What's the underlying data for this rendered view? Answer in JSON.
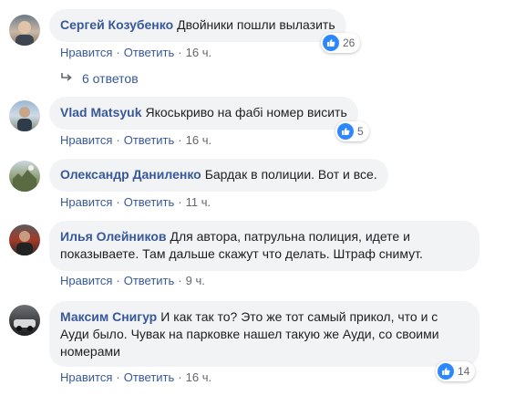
{
  "actions": {
    "like": "Нравится",
    "reply": "Ответить",
    "sep": "·"
  },
  "comments": [
    {
      "author": "Сергей Козубенко",
      "text": "Двойники пошли вылазить",
      "time": "16 ч.",
      "likes": "26"
    },
    {
      "author": "Vlad Matsyuk",
      "text": "Якоськриво на фабі номер висить",
      "time": "16 ч.",
      "likes": "5"
    },
    {
      "author": "Олександр Даниленко",
      "text": "Бардак в полиции. Вот и все.",
      "time": "11 ч."
    },
    {
      "author": "Илья Олейников",
      "text": "Для автора, патрульна полиция, идете и показываете. Там дальше скажут что делать. Штраф снимут.",
      "time": "9 ч."
    },
    {
      "author": "Максим Снигур",
      "text": "И как так то? Это же тот самый прикол, что и с Ауди было. Чувак на парковке нашел такую же Ауди, со своими номерами",
      "time": "16 ч.",
      "likes": "14"
    }
  ],
  "replies": {
    "label": "6 ответов"
  }
}
